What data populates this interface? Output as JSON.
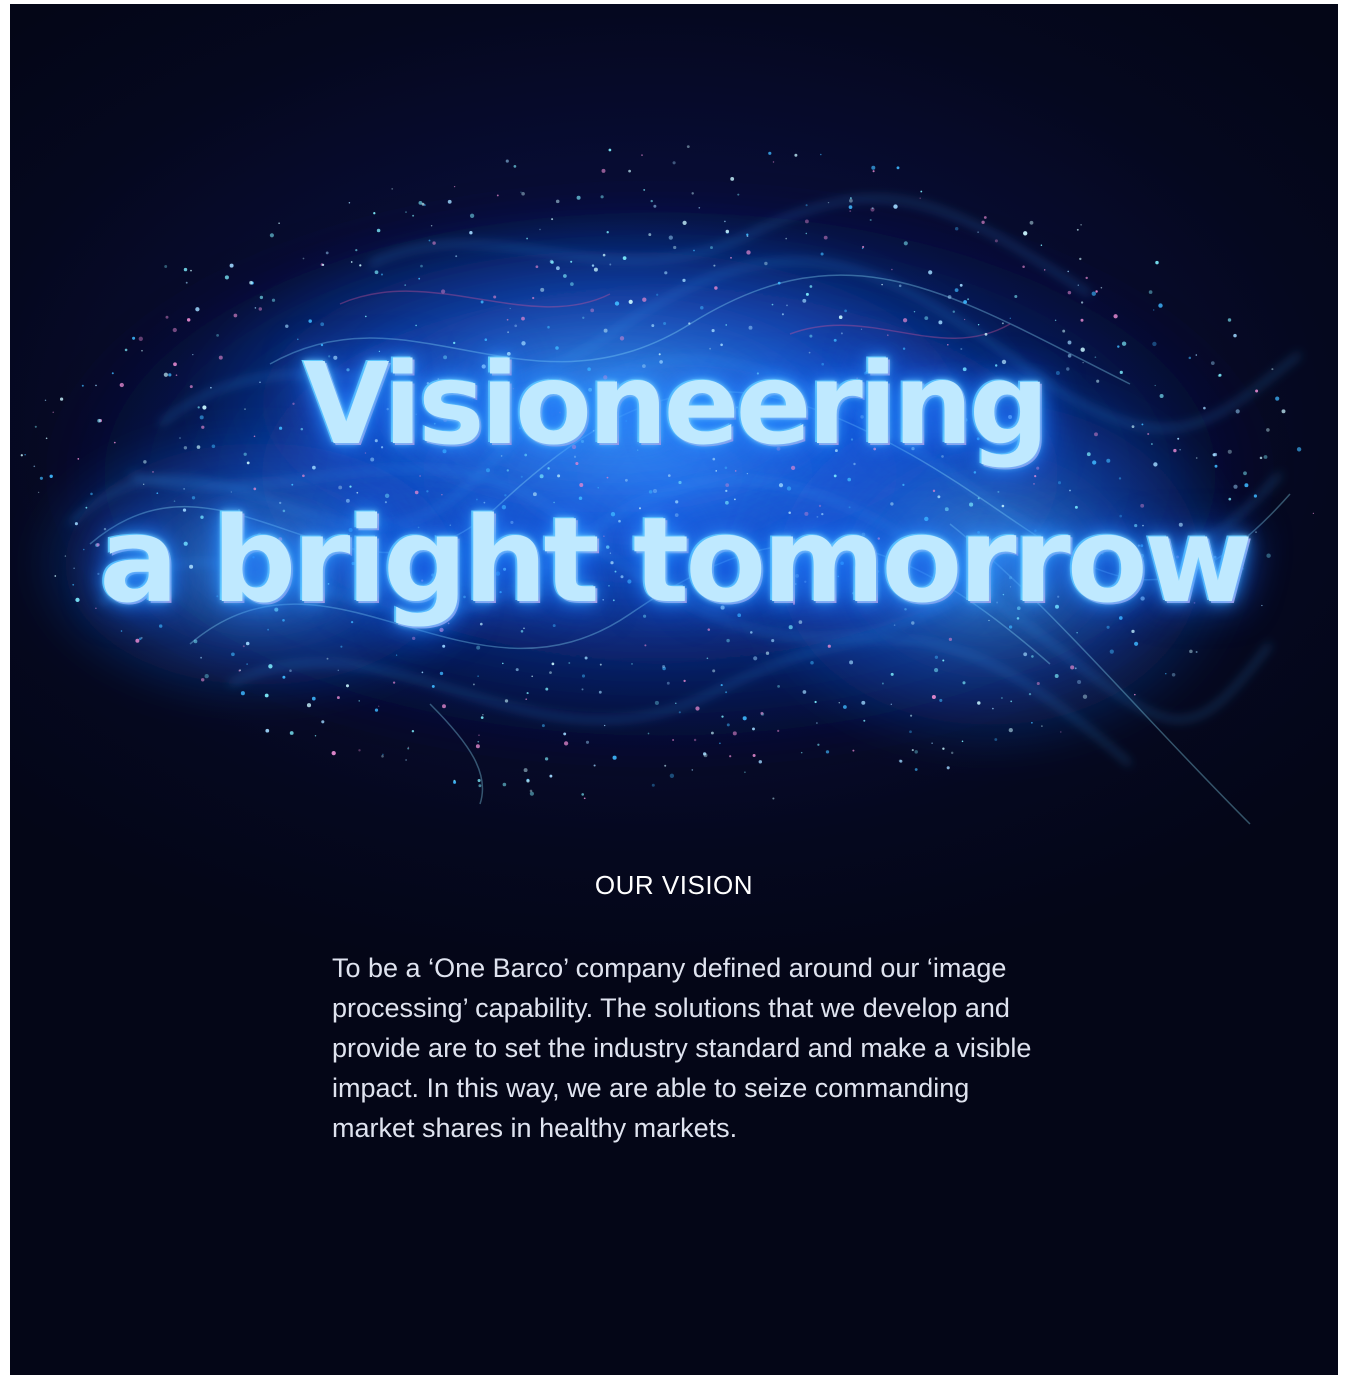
{
  "headline": {
    "line1": "Visioneering",
    "line2": "a bright tomorrow"
  },
  "vision": {
    "title": "OUR VISION",
    "body": "To be a ‘One Barco’ company defined around our ‘image processing’ capability. The solutions that we develop and provide are to set the industry standard and make a visible impact. In this way, we are able to seize commanding market shares in healthy markets."
  },
  "colors": {
    "background": "#05081f",
    "glow_blue": "#1e7bff",
    "cyan": "#6ff3ff",
    "magenta": "#e89ad8",
    "text": "#ffffff"
  }
}
